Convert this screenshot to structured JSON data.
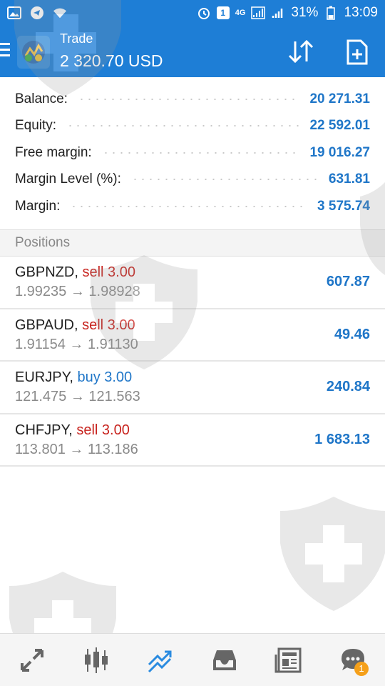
{
  "statusbar": {
    "network": "4G",
    "sim": "1",
    "battery": "31%",
    "time": "13:09"
  },
  "appbar": {
    "title": "Trade",
    "balance": "2 320.70 USD"
  },
  "summary": [
    {
      "label": "Balance:",
      "value": "20 271.31"
    },
    {
      "label": "Equity:",
      "value": "22 592.01"
    },
    {
      "label": "Free margin:",
      "value": "19 016.27"
    },
    {
      "label": "Margin Level (%):",
      "value": "631.81"
    },
    {
      "label": "Margin:",
      "value": "3 575.74"
    }
  ],
  "positions_header": "Positions",
  "positions": [
    {
      "symbol": "GBPNZD,",
      "side": "sell 3.00",
      "side_type": "sell",
      "open": "1.99235",
      "arrow": "→",
      "current": "1.98928",
      "profit": "607.87"
    },
    {
      "symbol": "GBPAUD,",
      "side": "sell 3.00",
      "side_type": "sell",
      "open": "1.91154",
      "arrow": "→",
      "current": "1.91130",
      "profit": "49.46"
    },
    {
      "symbol": "EURJPY,",
      "side": "buy 3.00",
      "side_type": "buy",
      "open": "121.475",
      "arrow": "→",
      "current": "121.563",
      "profit": "240.84"
    },
    {
      "symbol": "CHFJPY,",
      "side": "sell 3.00",
      "side_type": "sell",
      "open": "113.801",
      "arrow": "→",
      "current": "113.186",
      "profit": "1 683.13"
    }
  ],
  "bottomnav": {
    "items": [
      "quotes-icon",
      "chart-icon",
      "trade-icon",
      "history-icon",
      "news-icon",
      "chat-icon"
    ],
    "chat_badge": "1"
  },
  "colors": {
    "primary": "#1e7ed6",
    "value_blue": "#1f76c8",
    "sell_red": "#c8241f"
  }
}
